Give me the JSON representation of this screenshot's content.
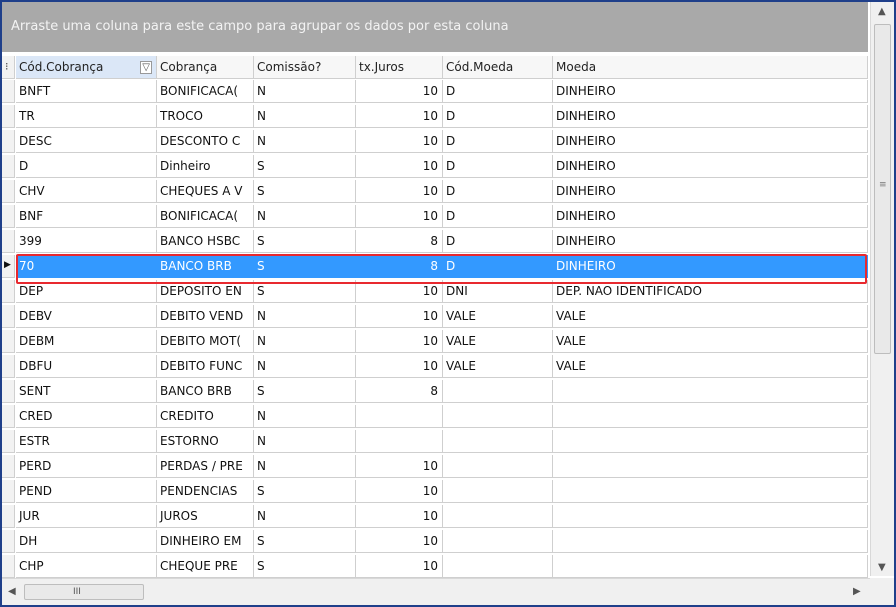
{
  "group_panel": {
    "text": "Arraste uma coluna para este campo para agrupar os dados por esta coluna"
  },
  "columns": [
    "Cód.Cobrança",
    "Cobrança",
    "Comissão?",
    "tx.Juros",
    "Cód.Moeda",
    "Moeda"
  ],
  "rows": [
    [
      "BNFT",
      "BONIFICACA(",
      "N",
      "10",
      "D",
      "DINHEIRO"
    ],
    [
      "TR",
      "TROCO",
      "N",
      "10",
      "D",
      "DINHEIRO"
    ],
    [
      "DESC",
      "DESCONTO C",
      "N",
      "10",
      "D",
      "DINHEIRO"
    ],
    [
      "D",
      "Dinheiro",
      "S",
      "10",
      "D",
      "DINHEIRO"
    ],
    [
      "CHV",
      "CHEQUES A V",
      "S",
      "10",
      "D",
      "DINHEIRO"
    ],
    [
      "BNF",
      "BONIFICACA(",
      "N",
      "10",
      "D",
      "DINHEIRO"
    ],
    [
      "399",
      "BANCO HSBC",
      "S",
      "8",
      "D",
      "DINHEIRO"
    ],
    [
      "70",
      "BANCO BRB",
      "S",
      "8",
      "D",
      "DINHEIRO"
    ],
    [
      "DEP",
      "DEPOSITO EN",
      "S",
      "10",
      "DNI",
      "DEP. NAO IDENTIFICADO"
    ],
    [
      "DEBV",
      "DEBITO VEND",
      "N",
      "10",
      "VALE",
      "VALE"
    ],
    [
      "DEBM",
      "DEBITO MOT(",
      "N",
      "10",
      "VALE",
      "VALE"
    ],
    [
      "DBFU",
      "DEBITO FUNC",
      "N",
      "10",
      "VALE",
      "VALE"
    ],
    [
      "SENT",
      "BANCO BRB",
      "S",
      "8",
      "",
      ""
    ],
    [
      "CRED",
      "CREDITO",
      "N",
      "",
      "",
      ""
    ],
    [
      "ESTR",
      "ESTORNO",
      "N",
      "",
      "",
      ""
    ],
    [
      "PERD",
      "PERDAS / PRE",
      "N",
      "10",
      "",
      ""
    ],
    [
      "PEND",
      "PENDENCIAS",
      "S",
      "10",
      "",
      ""
    ],
    [
      "JUR",
      "JUROS",
      "N",
      "10",
      "",
      ""
    ],
    [
      "DH",
      "DINHEIRO EM",
      "S",
      "10",
      "",
      ""
    ],
    [
      "CHP",
      "CHEQUE PRE",
      "S",
      "10",
      "",
      ""
    ]
  ],
  "selected_row_index": 7,
  "colors": {
    "selection": "#3399ff",
    "highlight_box": "#e8292f",
    "group_panel": "#a9a9a9"
  },
  "icons": {
    "column_chooser": "grid-icon",
    "filter": "filter-icon",
    "row_pointer": "triangle-right-icon"
  },
  "scrollbar": {
    "h_thumb_grip": "III"
  }
}
